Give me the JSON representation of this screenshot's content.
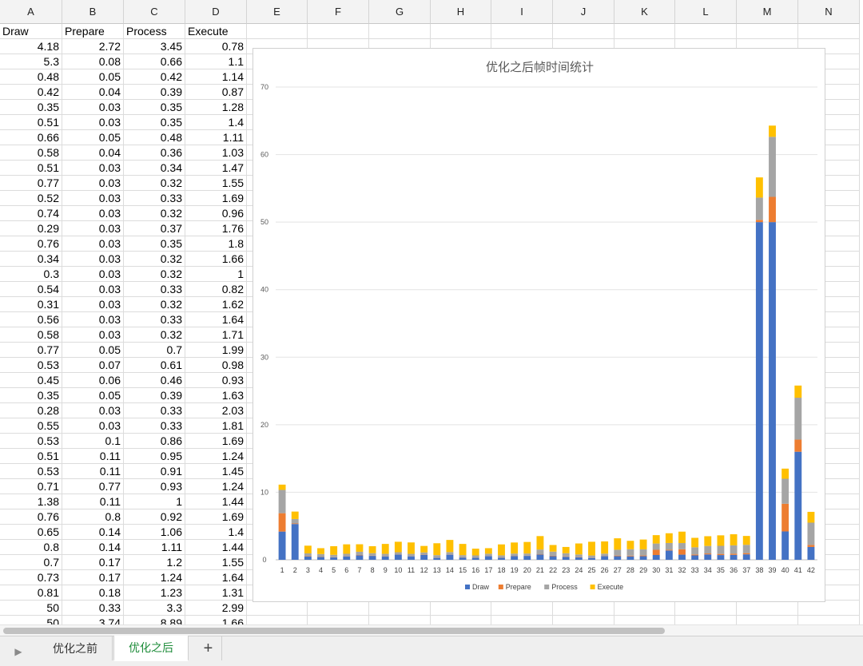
{
  "columns": [
    "A",
    "B",
    "C",
    "D",
    "E",
    "F",
    "G",
    "H",
    "I",
    "J",
    "K",
    "L",
    "M",
    "N"
  ],
  "headers": [
    "Draw",
    "Prepare",
    "Process",
    "Execute"
  ],
  "rows": [
    [
      "4.18",
      "2.72",
      "3.45",
      "0.78"
    ],
    [
      "5.3",
      "0.08",
      "0.66",
      "1.1"
    ],
    [
      "0.48",
      "0.05",
      "0.42",
      "1.14"
    ],
    [
      "0.42",
      "0.04",
      "0.39",
      "0.87"
    ],
    [
      "0.35",
      "0.03",
      "0.35",
      "1.28"
    ],
    [
      "0.51",
      "0.03",
      "0.35",
      "1.4"
    ],
    [
      "0.66",
      "0.05",
      "0.48",
      "1.11"
    ],
    [
      "0.58",
      "0.04",
      "0.36",
      "1.03"
    ],
    [
      "0.51",
      "0.03",
      "0.34",
      "1.47"
    ],
    [
      "0.77",
      "0.03",
      "0.32",
      "1.55"
    ],
    [
      "0.52",
      "0.03",
      "0.33",
      "1.69"
    ],
    [
      "0.74",
      "0.03",
      "0.32",
      "0.96"
    ],
    [
      "0.29",
      "0.03",
      "0.37",
      "1.76"
    ],
    [
      "0.76",
      "0.03",
      "0.35",
      "1.8"
    ],
    [
      "0.34",
      "0.03",
      "0.32",
      "1.66"
    ],
    [
      "0.3",
      "0.03",
      "0.32",
      "1"
    ],
    [
      "0.54",
      "0.03",
      "0.33",
      "0.82"
    ],
    [
      "0.31",
      "0.03",
      "0.32",
      "1.62"
    ],
    [
      "0.56",
      "0.03",
      "0.33",
      "1.64"
    ],
    [
      "0.58",
      "0.03",
      "0.32",
      "1.71"
    ],
    [
      "0.77",
      "0.05",
      "0.7",
      "1.99"
    ],
    [
      "0.53",
      "0.07",
      "0.61",
      "0.98"
    ],
    [
      "0.45",
      "0.06",
      "0.46",
      "0.93"
    ],
    [
      "0.35",
      "0.05",
      "0.39",
      "1.63"
    ],
    [
      "0.28",
      "0.03",
      "0.33",
      "2.03"
    ],
    [
      "0.55",
      "0.03",
      "0.33",
      "1.81"
    ],
    [
      "0.53",
      "0.1",
      "0.86",
      "1.69"
    ],
    [
      "0.51",
      "0.11",
      "0.95",
      "1.24"
    ],
    [
      "0.53",
      "0.11",
      "0.91",
      "1.45"
    ],
    [
      "0.71",
      "0.77",
      "0.93",
      "1.24"
    ],
    [
      "1.38",
      "0.11",
      "1",
      "1.44"
    ],
    [
      "0.76",
      "0.8",
      "0.92",
      "1.69"
    ],
    [
      "0.65",
      "0.14",
      "1.06",
      "1.4"
    ],
    [
      "0.8",
      "0.14",
      "1.11",
      "1.44"
    ],
    [
      "0.7",
      "0.17",
      "1.2",
      "1.55"
    ],
    [
      "0.73",
      "0.17",
      "1.24",
      "1.64"
    ],
    [
      "0.81",
      "0.18",
      "1.23",
      "1.31"
    ],
    [
      "50",
      "0.33",
      "3.3",
      "2.99"
    ],
    [
      "50",
      "3.74",
      "8.89",
      "1.66"
    ]
  ],
  "tabs": [
    {
      "label": "优化之前",
      "active": false
    },
    {
      "label": "优化之后",
      "active": true
    }
  ],
  "add_tab_label": "+",
  "chart_data": {
    "type": "bar",
    "stacked": true,
    "title": "优化之后帧时间统计",
    "categories": [
      "1",
      "2",
      "3",
      "4",
      "5",
      "6",
      "7",
      "8",
      "9",
      "10",
      "11",
      "12",
      "13",
      "14",
      "15",
      "16",
      "17",
      "18",
      "19",
      "20",
      "21",
      "22",
      "23",
      "24",
      "25",
      "26",
      "27",
      "28",
      "29",
      "30",
      "31",
      "32",
      "33",
      "34",
      "35",
      "36",
      "37",
      "38",
      "39",
      "40",
      "41",
      "42"
    ],
    "series": [
      {
        "name": "Draw",
        "color": "#4472c4",
        "values": [
          4.18,
          5.3,
          0.48,
          0.42,
          0.35,
          0.51,
          0.66,
          0.58,
          0.51,
          0.77,
          0.52,
          0.74,
          0.29,
          0.76,
          0.34,
          0.3,
          0.54,
          0.31,
          0.56,
          0.58,
          0.77,
          0.53,
          0.45,
          0.35,
          0.28,
          0.55,
          0.53,
          0.51,
          0.53,
          0.71,
          1.38,
          0.76,
          0.65,
          0.8,
          0.7,
          0.73,
          0.81,
          50,
          50,
          4.2,
          16,
          1.9
        ]
      },
      {
        "name": "Prepare",
        "color": "#ed7d31",
        "values": [
          2.72,
          0.08,
          0.05,
          0.04,
          0.03,
          0.03,
          0.05,
          0.04,
          0.03,
          0.03,
          0.03,
          0.03,
          0.03,
          0.03,
          0.03,
          0.03,
          0.03,
          0.03,
          0.03,
          0.03,
          0.05,
          0.07,
          0.06,
          0.05,
          0.03,
          0.03,
          0.1,
          0.11,
          0.11,
          0.77,
          0.11,
          0.8,
          0.14,
          0.14,
          0.17,
          0.17,
          0.18,
          0.33,
          3.74,
          4.1,
          1.8,
          0.3
        ]
      },
      {
        "name": "Process",
        "color": "#a5a5a5",
        "values": [
          3.45,
          0.66,
          0.42,
          0.39,
          0.35,
          0.35,
          0.48,
          0.36,
          0.34,
          0.32,
          0.33,
          0.32,
          0.37,
          0.35,
          0.32,
          0.32,
          0.33,
          0.32,
          0.33,
          0.32,
          0.7,
          0.61,
          0.46,
          0.39,
          0.33,
          0.33,
          0.86,
          0.95,
          0.91,
          0.93,
          1,
          0.92,
          1.06,
          1.11,
          1.2,
          1.24,
          1.23,
          3.3,
          8.89,
          3.7,
          6.2,
          3.3
        ]
      },
      {
        "name": "Execute",
        "color": "#ffc000",
        "values": [
          0.78,
          1.1,
          1.14,
          0.87,
          1.28,
          1.4,
          1.11,
          1.03,
          1.47,
          1.55,
          1.69,
          0.96,
          1.76,
          1.8,
          1.66,
          1,
          0.82,
          1.62,
          1.64,
          1.71,
          1.99,
          0.98,
          0.93,
          1.63,
          2.03,
          1.81,
          1.69,
          1.24,
          1.45,
          1.24,
          1.44,
          1.69,
          1.4,
          1.44,
          1.55,
          1.64,
          1.31,
          2.99,
          1.66,
          1.5,
          1.8,
          1.6
        ]
      }
    ],
    "ylim": [
      0,
      70
    ],
    "yticks": [
      0,
      10,
      20,
      30,
      40,
      50,
      60,
      70
    ],
    "grid": true,
    "legend_position": "bottom"
  }
}
